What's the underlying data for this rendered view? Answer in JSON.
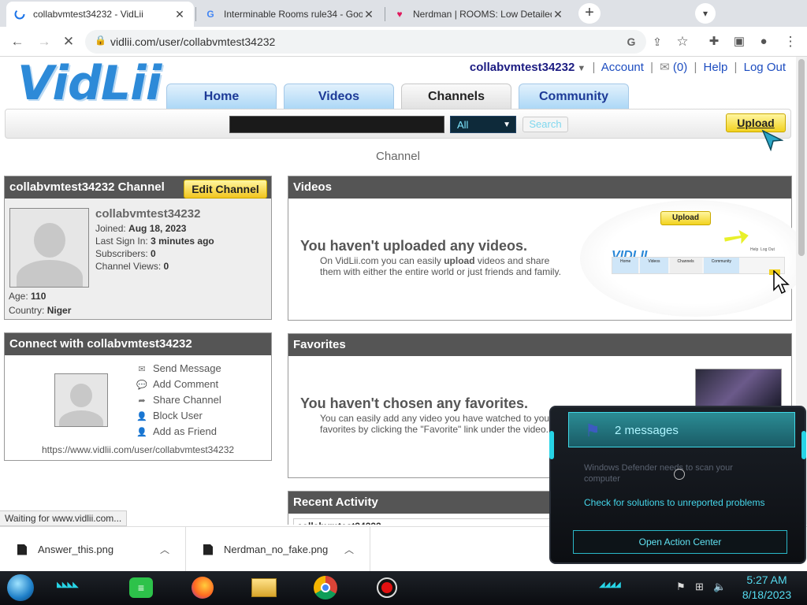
{
  "browser": {
    "tabs": [
      {
        "title": "collabvmtest34232 - VidLii",
        "icon": "loading-spinner-icon"
      },
      {
        "title": "Interminable Rooms rule34 - Goo",
        "icon": "google-icon"
      },
      {
        "title": "Nerdman | ROOMS: Low Detailed",
        "icon": "fandom-icon"
      }
    ],
    "new_tab": "+",
    "close": "✕",
    "url": "vidlii.com/user/collabvmtest34232",
    "status": "Waiting for www.vidlii.com..."
  },
  "site": {
    "logo": "VidLii",
    "username": "collabvmtest34232",
    "links": {
      "account": "Account",
      "inbox": "(0)",
      "help": "Help",
      "logout": "Log Out"
    },
    "nav": [
      "Home",
      "Videos",
      "Channels",
      "Community"
    ],
    "search_select": "All",
    "search_button": "Search",
    "upload": "Upload",
    "page_heading": "Channel"
  },
  "channel_info": {
    "title": "collabvmtest34232 Channel",
    "edit_button": "Edit Channel",
    "name": "collabvmtest34232",
    "joined_label": "Joined:",
    "joined": "Aug 18, 2023",
    "signin_label": "Last Sign In:",
    "signin": "3 minutes ago",
    "subs_label": "Subscribers:",
    "subs": "0",
    "views_label": "Channel Views:",
    "views": "0",
    "age_label": "Age:",
    "age": "110",
    "country_label": "Country:",
    "country": "Niger"
  },
  "connect": {
    "title": "Connect with collabvmtest34232",
    "actions": [
      "Send Message",
      "Add Comment",
      "Share Channel",
      "Block User",
      "Add as Friend"
    ],
    "url": "https://www.vidlii.com/user/collabvmtest34232"
  },
  "videos": {
    "title": "Videos",
    "empty_title": "You haven't uploaded any videos.",
    "desc_1": "On VidLii.com you can easily",
    "desc_bold": "upload",
    "desc_2": "videos and share",
    "desc_3": "them with either the entire world or just friends and family.",
    "promo_upload": "Upload",
    "promo_nav": [
      "Home",
      "Videos",
      "Channels",
      "Community"
    ],
    "promo_logo": "VIDLII",
    "promo_links": "Help  Log Out"
  },
  "favorites": {
    "title": "Favorites",
    "empty_title": "You haven't chosen any favorites.",
    "desc_1": "You can easily add any video you have watched to you",
    "desc_2": "favorites by clicking the \"Favorite\" link under the video."
  },
  "recent": {
    "title": "Recent Activity",
    "first_row": "collabvmtest34232"
  },
  "downloads": [
    {
      "name": "Answer_this.png"
    },
    {
      "name": "Nerdman_no_fake.png"
    }
  ],
  "action_center": {
    "messages": "2 messages",
    "defender": "Windows Defender needs to scan your computer",
    "check": "Check for solutions to unreported problems",
    "open": "Open Action Center"
  },
  "taskbar": {
    "time": "5:27 AM",
    "date": "8/18/2023",
    "apps": [
      "start-orb-icon",
      "notes-app-icon",
      "firefox-icon",
      "file-explorer-icon",
      "chrome-icon",
      "record-icon"
    ]
  },
  "colors": {
    "accent": "#2d8ad8",
    "panel_header": "#555555",
    "taskbar_glow": "#27d4e6"
  }
}
